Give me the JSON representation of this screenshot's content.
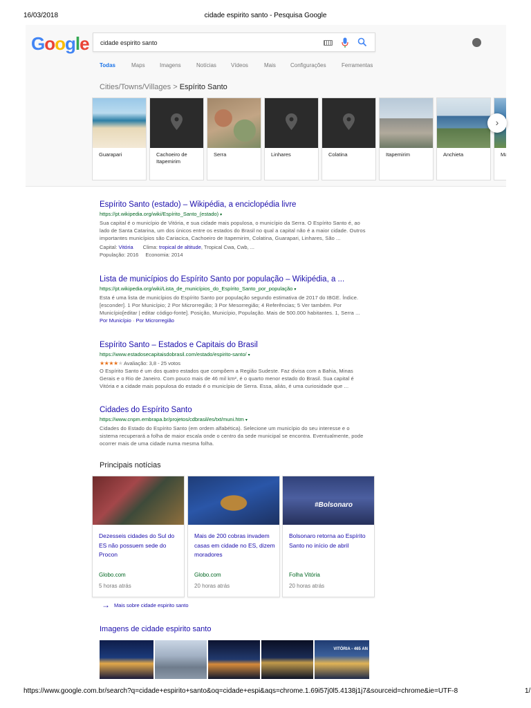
{
  "print_header": {
    "date": "16/03/2018",
    "title": "cidade espirito santo - Pesquisa Google"
  },
  "print_footer": {
    "url": "https://www.google.com.br/search?q=cidade+espirito+santo&oq=cidade+espi&aqs=chrome.1.69i57j0l5.4138j1j7&sourceid=chrome&ie=UTF-8",
    "page": "1/"
  },
  "logo": {
    "letters": [
      "G",
      "o",
      "o",
      "g",
      "l",
      "e"
    ]
  },
  "search": {
    "query": "cidade espirito santo"
  },
  "tabs": [
    "Todas",
    "Maps",
    "Imagens",
    "Notícias",
    "Vídeos",
    "Mais",
    "Configurações",
    "Ferramentas"
  ],
  "carousel": {
    "category": "Cities/Towns/Villages",
    "separator": ">",
    "current": "Espírito Santo",
    "cards": [
      {
        "label": "Guarapari",
        "has_image": true
      },
      {
        "label": "Cachoeiro de Itapemirim",
        "has_image": false
      },
      {
        "label": "Serra",
        "has_image": true
      },
      {
        "label": "Linhares",
        "has_image": false
      },
      {
        "label": "Colatina",
        "has_image": false
      },
      {
        "label": "Itapemirim",
        "has_image": true
      },
      {
        "label": "Anchieta",
        "has_image": true
      },
      {
        "label": "Ma",
        "has_image": true
      }
    ],
    "next": "›"
  },
  "results": [
    {
      "title": "Espírito Santo (estado) – Wikipédia, a enciclopédia livre",
      "url": "https://pt.wikipedia.org/wiki/Espírito_Santo_(estado)",
      "snippet": "Sua capital é o município de Vitória, e sua cidade mais populosa, o município da Serra. O Espírito Santo é, ao lado de Santa Catarina, um dos únicos entre os estados do Brasil no qual a capital não é a maior cidade. Outros importantes municípios são Cariacica, Cachoeiro de Itapemirim, Colatina, Guarapari, Linhares, São ...",
      "meta": [
        {
          "k": "Capital:",
          "v": "Vitória",
          "link": true,
          "k2": "Clima:",
          "v2": "tropical de altitude",
          "rest": ", Tropical Cwa, Cwb, ..."
        },
        {
          "k": "População:",
          "v": "2016",
          "link": false,
          "k2": "Economia:",
          "v2": "2014",
          "rest": ""
        }
      ]
    },
    {
      "title": "Lista de municípios do Espírito Santo por população – Wikipédia, a ...",
      "url": "https://pt.wikipedia.org/wiki/Lista_de_municípios_do_Espírito_Santo_por_população",
      "snippet": "Esta é uma lista de municípios do Espírito Santo por população segundo estimativa de 2017 do IBGE. Índice. [esconder]. 1 Por Município; 2 Por Microrregião; 3 Por Mesorregião; 4 Referências; 5 Ver também. Por Município[editar | editar código-fonte]. Posição, Município, População. Mais de 500.000 habitantes. 1, Serra ...",
      "links": [
        "Por Município",
        "Por Microrregião"
      ],
      "links_sep": "·"
    },
    {
      "title": "Espírito Santo – Estados e Capitais do Brasil",
      "url": "https://www.estadosecapitaisdobrasil.com/estado/espirito-santo/",
      "rating": {
        "stars": 3.8,
        "text": "Avaliação: 3,8 - 25 votos"
      },
      "snippet": "O Espírito Santo é um dos quatro estados que compõem a Região Sudeste. Faz divisa com a Bahia, Minas Gerais e o Rio de Janeiro. Com pouco mais de 46 mil km², é o quarto menor estado do Brasil. Sua capital é Vitória e a cidade mais populosa do estado é o município de Serra. Essa, aliás, é uma curiosidade que ..."
    },
    {
      "title": "Cidades do Espírito Santo",
      "url": "https://www.cnpm.embrapa.br/projetos/cdbrasil/es/txt/muni.htm",
      "snippet": "Cidades do Estado do Espírito Santo (em ordem alfabética). Selecione um município do seu interesse e o sistema recuperará a folha de maior escala onde o centro da sede municipal se encontra. Eventualmente, pode ocorrer mais de uma cidade numa mesma folha."
    }
  ],
  "news": {
    "heading": "Principais notícias",
    "items": [
      {
        "title": "Dezesseis cidades do Sul do ES não possuem sede do Procon",
        "source": "Globo.com",
        "time": "5 horas atrás"
      },
      {
        "title": "Mais de 200 cobras invadem casas em cidade no ES, dizem moradores",
        "source": "Globo.com",
        "time": "20 horas atrás"
      },
      {
        "title": "Bolsonaro retorna ao Espírito Santo no início de abril",
        "source": "Folha Vitória",
        "time": "20 horas atrás",
        "image_tag": "#Bolsonaro"
      }
    ],
    "more": "Mais sobre cidade espirito santo",
    "more_arrow": "→"
  },
  "images": {
    "heading": "Imagens de cidade espirito santo",
    "thumb_tag": "VITÓRIA - 465 AN"
  },
  "colors": {
    "link": "#1a0dab",
    "url_green": "#006621",
    "snippet": "#545454",
    "tab_active": "#1a73e8",
    "star": "#e7711b"
  }
}
